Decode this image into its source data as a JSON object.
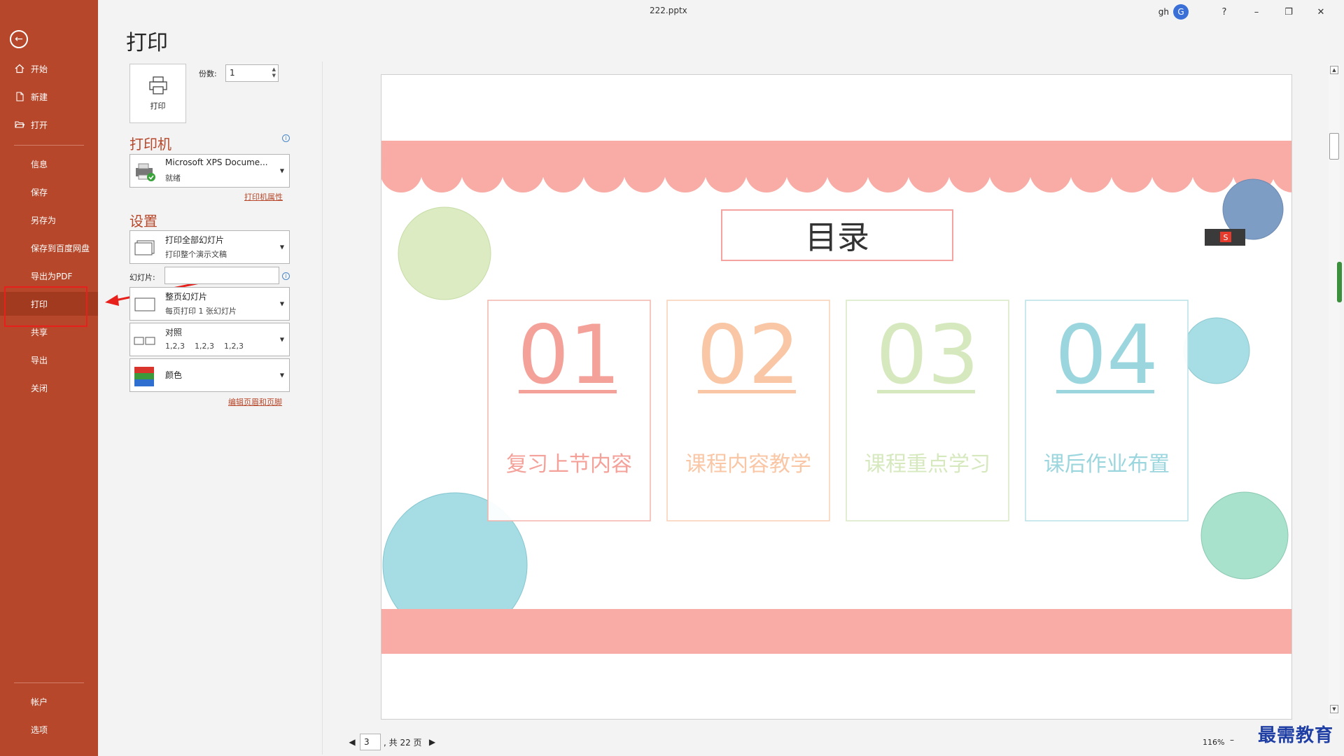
{
  "window": {
    "file_title": "222.pptx",
    "user_initials": "gh",
    "avatar_letter": "G",
    "help": "?",
    "minimize": "–",
    "restore": "❐",
    "close": "✕"
  },
  "sidebar": {
    "back_icon": "back-arrow-icon",
    "items": [
      {
        "label": "开始",
        "icon": "home-icon"
      },
      {
        "label": "新建",
        "icon": "new-file-icon"
      },
      {
        "label": "打开",
        "icon": "folder-open-icon"
      },
      {
        "label": "信息"
      },
      {
        "label": "保存"
      },
      {
        "label": "另存为"
      },
      {
        "label": "保存到百度网盘"
      },
      {
        "label": "导出为PDF"
      },
      {
        "label": "打印",
        "active": true
      },
      {
        "label": "共享"
      },
      {
        "label": "导出"
      },
      {
        "label": "关闭"
      }
    ],
    "bottom_items": [
      {
        "label": "帐户"
      },
      {
        "label": "选项"
      }
    ],
    "bg_color": "#b7472a"
  },
  "print_panel": {
    "title": "打印",
    "print_button_label": "打印",
    "copies_label": "份数:",
    "copies_value": "1",
    "printer_heading": "打印机",
    "printer_name": "Microsoft XPS Docume...",
    "printer_status": "就绪",
    "printer_properties_link": "打印机属性",
    "settings_heading": "设置",
    "range_main": "打印全部幻灯片",
    "range_sub": "打印整个演示文稿",
    "slides_label": "幻灯片:",
    "slides_value": "",
    "layout_main": "整页幻灯片",
    "layout_sub": "每页打印 1 张幻灯片",
    "collate_main": "对照",
    "collate_sub": "1,2,3    1,2,3    1,2,3",
    "color_main": "颜色",
    "header_footer_link": "编辑页眉和页脚"
  },
  "preview": {
    "slide_title": "目录",
    "items": [
      {
        "num": "01",
        "text": "复习上节内容",
        "color": "#f4a19a"
      },
      {
        "num": "02",
        "text": "课程内容教学",
        "color": "#f9c7a6"
      },
      {
        "num": "03",
        "text": "课程重点学习",
        "color": "#d6e9be"
      },
      {
        "num": "04",
        "text": "课后作业布置",
        "color": "#9bd6de"
      }
    ]
  },
  "pager": {
    "current": "3",
    "total_text": ", 共 22 页",
    "prev": "◀",
    "next": "▶"
  },
  "zoom": {
    "percent": "116%",
    "minus": "–"
  },
  "watermark": "最需教育"
}
